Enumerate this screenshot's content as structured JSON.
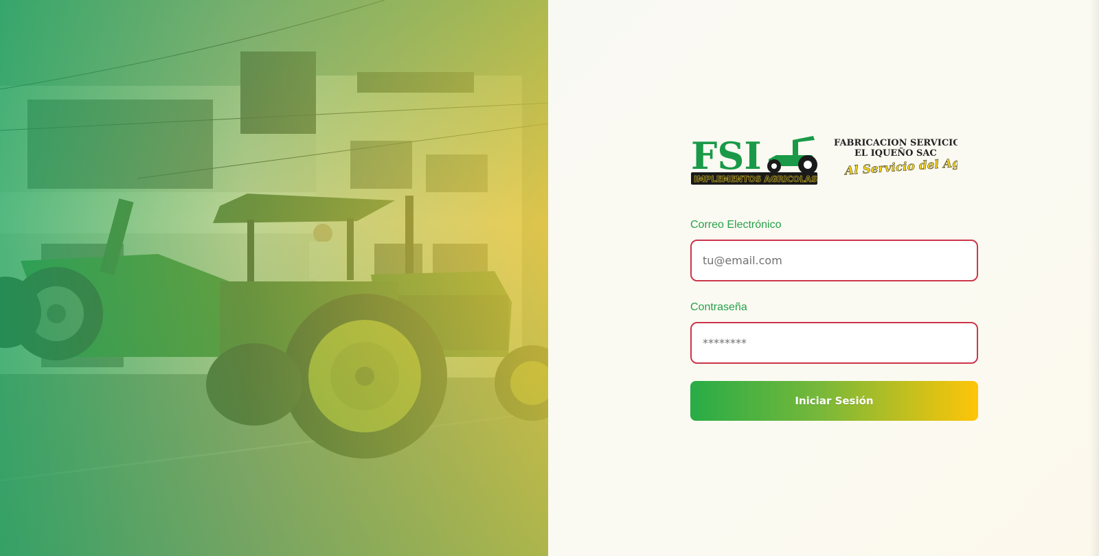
{
  "brand": {
    "logo_main": "FSI",
    "logo_sub": "IMPLEMENTOS AGRICOLAS",
    "company_line1": "FABRICACION  SERVICIOS",
    "company_line2": "EL IQUEÑO SAC",
    "slogan": "Al Servicio del Agro",
    "primary_color": "#28ac46",
    "accent_color": "#ffc508",
    "error_border_color": "#cc3548"
  },
  "hero": {
    "icon": "tractor-photo"
  },
  "form": {
    "email": {
      "label": "Correo Electrónico",
      "placeholder": "tu@email.com",
      "value": ""
    },
    "password": {
      "label": "Contraseña",
      "placeholder": "********",
      "value": ""
    },
    "submit_label": "Iniciar Sesión"
  }
}
